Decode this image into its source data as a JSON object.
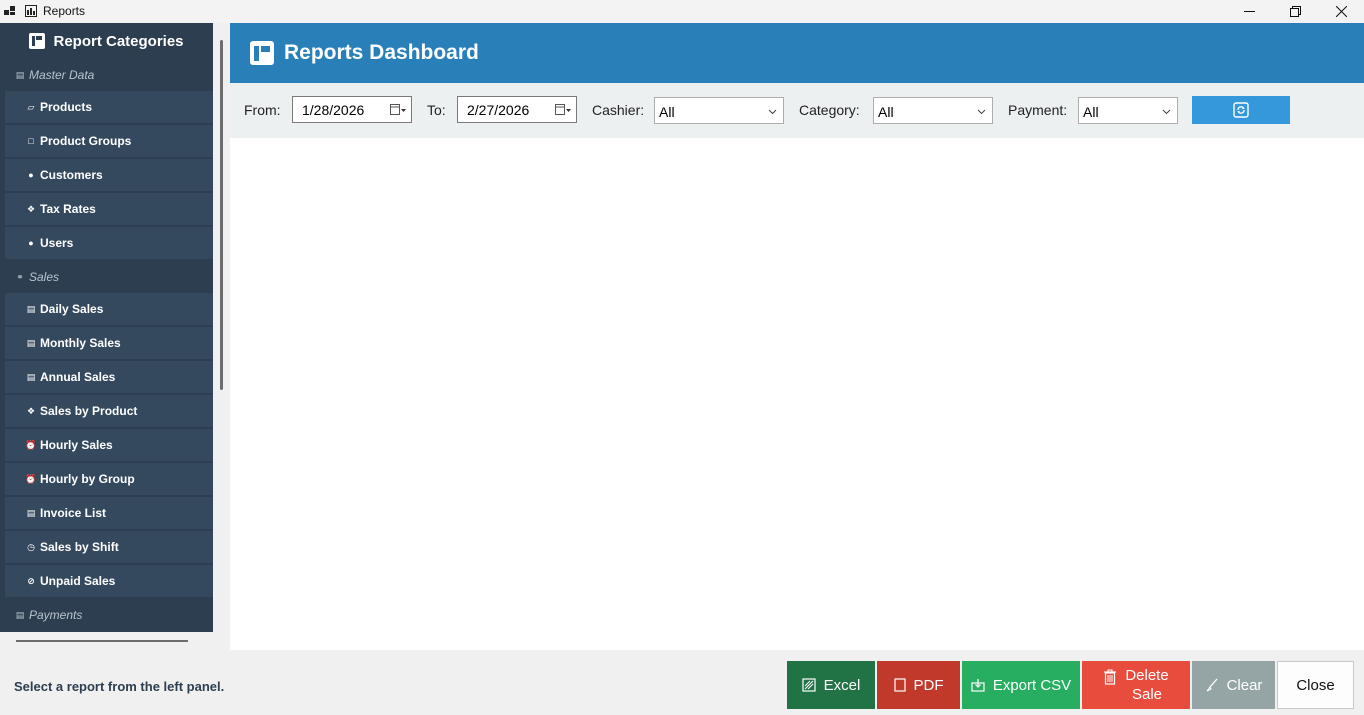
{
  "window": {
    "title": "Reports"
  },
  "sidebar": {
    "header": "Report Categories",
    "groups": [
      {
        "section": "Master Data",
        "items": [
          "Products",
          "Product Groups",
          "Customers",
          "Tax Rates",
          "Users"
        ]
      },
      {
        "section": "Sales",
        "items": [
          "Daily Sales",
          "Monthly Sales",
          "Annual Sales",
          "Sales by Product",
          "Hourly Sales",
          "Hourly by Group",
          "Invoice List",
          "Sales by Shift",
          "Unpaid Sales"
        ]
      },
      {
        "section": "Payments",
        "items": []
      }
    ]
  },
  "main": {
    "title": "Reports Dashboard"
  },
  "filters": {
    "from_label": "From:",
    "from_value": "1/28/2026",
    "to_label": "To:",
    "to_value": "2/27/2026",
    "cashier_label": "Cashier:",
    "cashier_value": "All",
    "category_label": "Category:",
    "category_value": "All",
    "payment_label": "Payment:",
    "payment_value": "All"
  },
  "footer": {
    "status": "Select a report from the left panel.",
    "excel": "Excel",
    "pdf": "PDF",
    "export_csv": "Export CSV",
    "delete_sale_1": "Delete",
    "delete_sale_2": "Sale",
    "clear": "Clear",
    "close": "Close"
  },
  "colors": {
    "sidebar_bg": "#2c3e50",
    "sidebar_item": "#34495e",
    "header_blue": "#2980b9",
    "refresh_blue": "#3498db",
    "excel": "#217346",
    "pdf": "#c0392b",
    "csv": "#27ae60",
    "delete": "#e74c3c",
    "clear": "#95a5a6"
  }
}
